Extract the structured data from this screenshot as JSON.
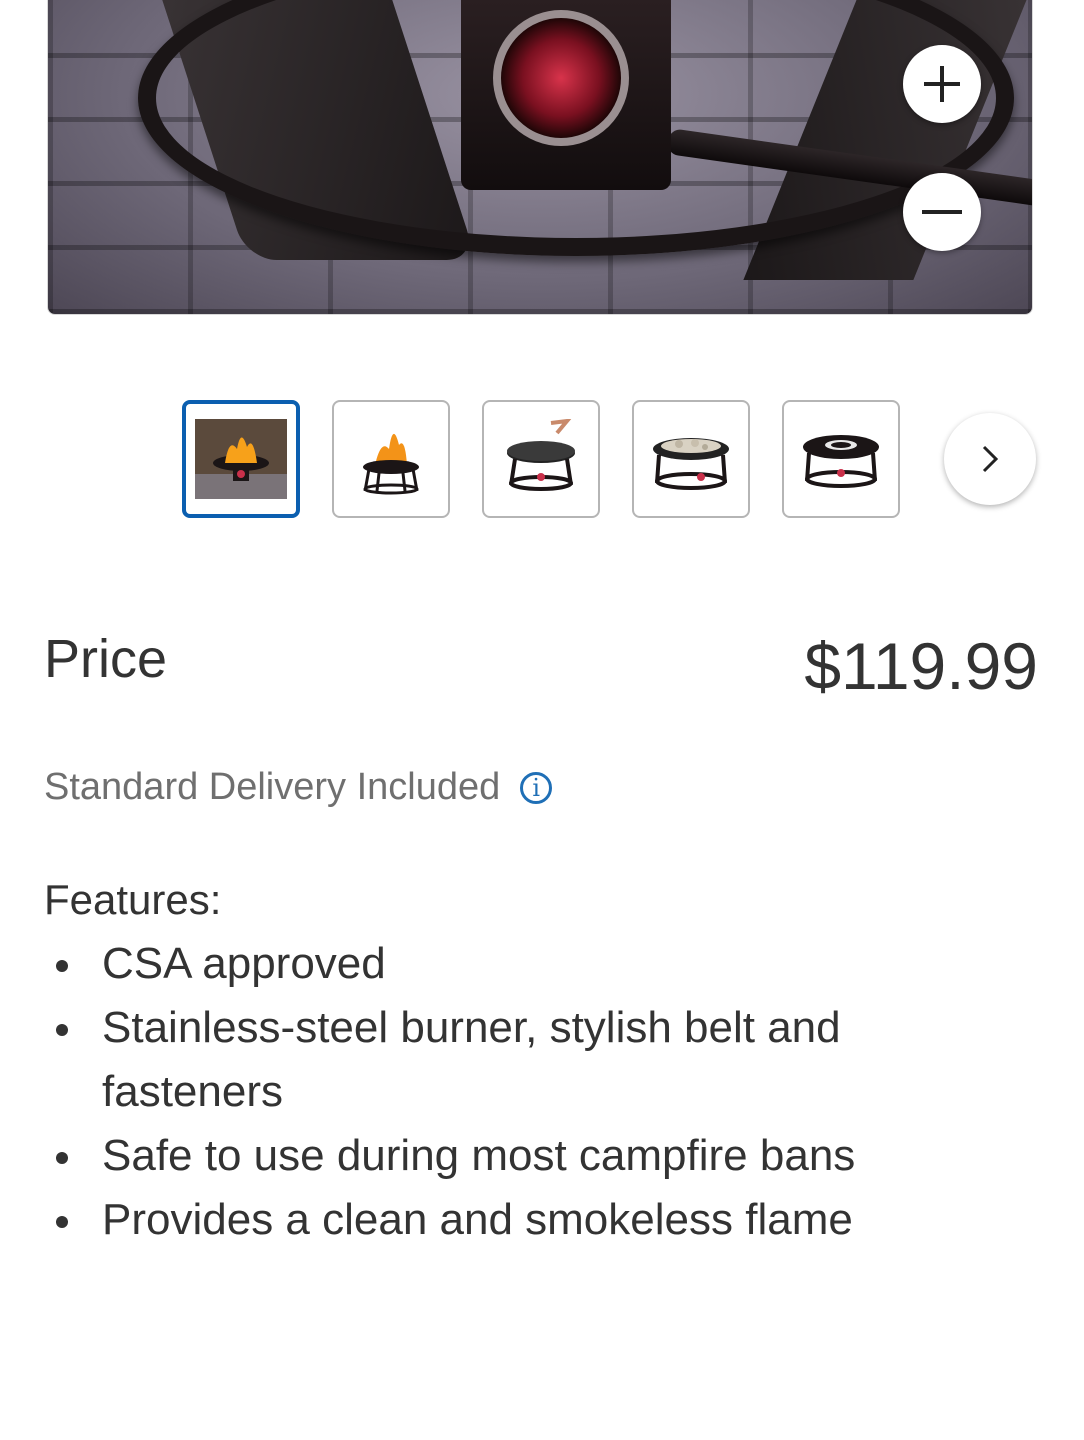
{
  "gallery": {
    "zoom_in_icon": "plus-icon",
    "zoom_out_icon": "minus-icon",
    "next_icon": "chevron-right-icon",
    "thumbnails": [
      {
        "name": "thumbnail-1",
        "active": true
      },
      {
        "name": "thumbnail-2",
        "active": false
      },
      {
        "name": "thumbnail-3",
        "active": false
      },
      {
        "name": "thumbnail-4",
        "active": false
      },
      {
        "name": "thumbnail-5",
        "active": false
      }
    ]
  },
  "price": {
    "label": "Price",
    "value": "$119.99"
  },
  "delivery": {
    "text": "Standard Delivery Included",
    "info_icon": "info-icon"
  },
  "features": {
    "title": "Features:",
    "items": [
      "CSA approved",
      "Stainless-steel burner, stylish belt and fasteners",
      "Safe to use during most campfire bans",
      "Provides a clean and smokeless flame"
    ]
  },
  "colors": {
    "accent": "#0b5fb0",
    "text": "#333333",
    "muted": "#6f6f6f"
  }
}
